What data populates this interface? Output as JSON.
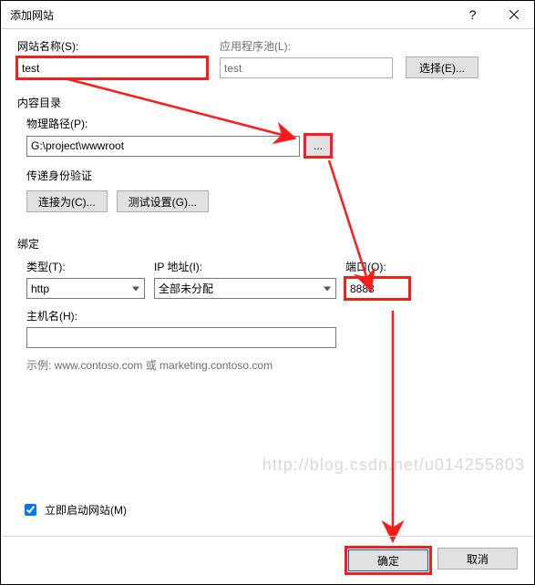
{
  "title": "添加网站",
  "labels": {
    "siteName": "网站名称(S):",
    "appPool": "应用程序池(L):",
    "select": "选择(E)...",
    "contentGroup": "内容目录",
    "physicalPath": "物理路径(P):",
    "passAuth": "传递身份验证",
    "connectAs": "连接为(C)...",
    "testSettings": "测试设置(G)...",
    "bindingGroup": "绑定",
    "type": "类型(T):",
    "ip": "IP 地址(I):",
    "port": "端口(O):",
    "hostName": "主机名(H):",
    "example": "示例: www.contoso.com 或 marketing.contoso.com",
    "startImmediately": "立即启动网站(M)",
    "ok": "确定",
    "cancel": "取消",
    "browse": "..."
  },
  "values": {
    "siteName": "test",
    "appPool": "test",
    "physicalPath": "G:\\project\\wwwroot",
    "type": "http",
    "ip": "全部未分配",
    "port": "8888",
    "hostName": "",
    "startChecked": true
  },
  "watermark": "http://blog.csdn.net/u014255803"
}
